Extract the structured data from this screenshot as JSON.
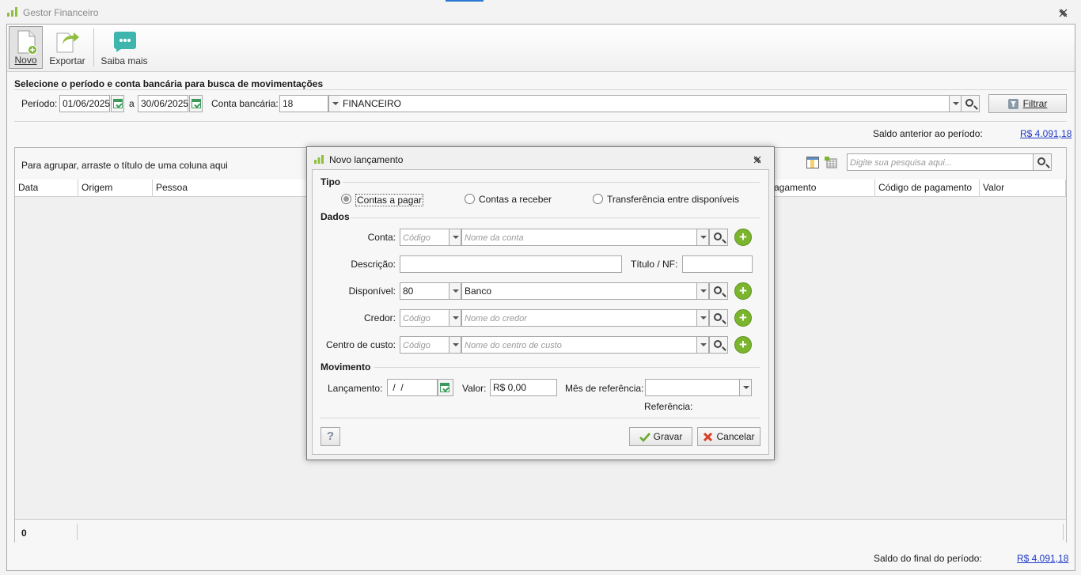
{
  "app": {
    "title": "Gestor Financeiro"
  },
  "ribbon": {
    "novo": "Novo",
    "exportar": "Exportar",
    "saiba_mais": "Saiba mais"
  },
  "search_panel": {
    "title": "Selecione o período e conta bancária para busca de movimentações",
    "periodo_label": "Período:",
    "date_from": "01/06/2025",
    "a_label": "a",
    "date_to": "30/06/2025",
    "conta_label": "Conta bancária:",
    "conta_code": "18",
    "conta_name": "FINANCEIRO",
    "filtrar": "Filtrar"
  },
  "saldo_anterior": {
    "label": "Saldo anterior ao período:",
    "value": "R$ 4.091,18"
  },
  "grid": {
    "group_hint": "Para agrupar, arraste o título de uma coluna aqui",
    "search_placeholder": "Digite sua pesquisa aqui...",
    "columns": [
      "Data",
      "Origem",
      "Pessoa",
      "agamento",
      "Código de pagamento",
      "Valor"
    ],
    "count": "0"
  },
  "saldo_final": {
    "label": "Saldo do final do período:",
    "value": "R$ 4.091,18"
  },
  "dialog": {
    "title": "Novo lançamento",
    "tipo_title": "Tipo",
    "tipo_options": [
      "Contas a pagar",
      "Contas a receber",
      "Transferência entre disponíveis"
    ],
    "tipo_selected": "Contas a pagar",
    "dados_title": "Dados",
    "conta_label": "Conta:",
    "codigo_ph": "Código",
    "conta_ph": "Nome da conta",
    "descricao_label": "Descrição:",
    "titulo_label": "Título / NF:",
    "disponivel_label": "Disponível:",
    "disponivel_code": "80",
    "disponivel_name": "Banco",
    "credor_label": "Credor:",
    "credor_ph": "Nome do credor",
    "centro_label": "Centro de custo:",
    "centro_ph": "Nome do centro de custo",
    "movimento_title": "Movimento",
    "lancamento_label": "Lançamento:",
    "lancamento_value": " /  /",
    "valor_label": "Valor:",
    "valor_value": "R$ 0,00",
    "mes_ref_label": "Mês de referência:",
    "referencia_label": "Referência:",
    "help": "?",
    "gravar": "Gravar",
    "cancelar": "Cancelar"
  },
  "colors": {
    "accent": "#2b78d4",
    "green": "#7bb52e",
    "link": "#1f39c7"
  }
}
